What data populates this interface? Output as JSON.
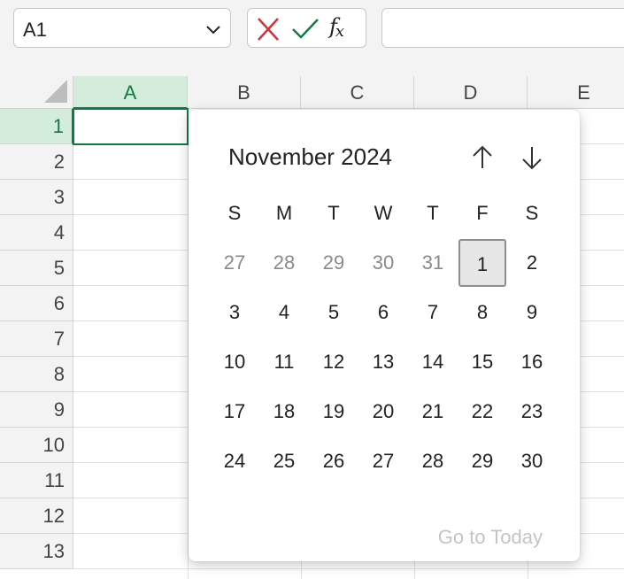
{
  "formula_bar": {
    "name_box": "A1",
    "cancel_icon": "x-icon",
    "enter_icon": "checkmark-icon",
    "fx_label": "f",
    "fx_sub": "x",
    "formula_value": "",
    "colors": {
      "cancel": "#d13438",
      "enter": "#107c41"
    }
  },
  "grid": {
    "columns": [
      "A",
      "B",
      "C",
      "D",
      "E"
    ],
    "rows": [
      "1",
      "2",
      "3",
      "4",
      "5",
      "6",
      "7",
      "8",
      "9",
      "10",
      "11",
      "12",
      "13"
    ],
    "selected_column": "A",
    "selected_row": "1",
    "accent": "#107c41"
  },
  "calendar": {
    "month_title": "November 2024",
    "weekday_headers": [
      "S",
      "M",
      "T",
      "W",
      "T",
      "F",
      "S"
    ],
    "weeks": [
      [
        {
          "d": "27",
          "other": true
        },
        {
          "d": "28",
          "other": true
        },
        {
          "d": "29",
          "other": true
        },
        {
          "d": "30",
          "other": true
        },
        {
          "d": "31",
          "other": true
        },
        {
          "d": "1",
          "selected": true
        },
        {
          "d": "2"
        }
      ],
      [
        {
          "d": "3"
        },
        {
          "d": "4"
        },
        {
          "d": "5"
        },
        {
          "d": "6"
        },
        {
          "d": "7"
        },
        {
          "d": "8"
        },
        {
          "d": "9"
        }
      ],
      [
        {
          "d": "10"
        },
        {
          "d": "11"
        },
        {
          "d": "12"
        },
        {
          "d": "13"
        },
        {
          "d": "14"
        },
        {
          "d": "15"
        },
        {
          "d": "16"
        }
      ],
      [
        {
          "d": "17"
        },
        {
          "d": "18"
        },
        {
          "d": "19"
        },
        {
          "d": "20"
        },
        {
          "d": "21"
        },
        {
          "d": "22"
        },
        {
          "d": "23"
        }
      ],
      [
        {
          "d": "24"
        },
        {
          "d": "25"
        },
        {
          "d": "26"
        },
        {
          "d": "27"
        },
        {
          "d": "28"
        },
        {
          "d": "29"
        },
        {
          "d": "30"
        }
      ]
    ],
    "go_to_today": "Go to Today"
  }
}
